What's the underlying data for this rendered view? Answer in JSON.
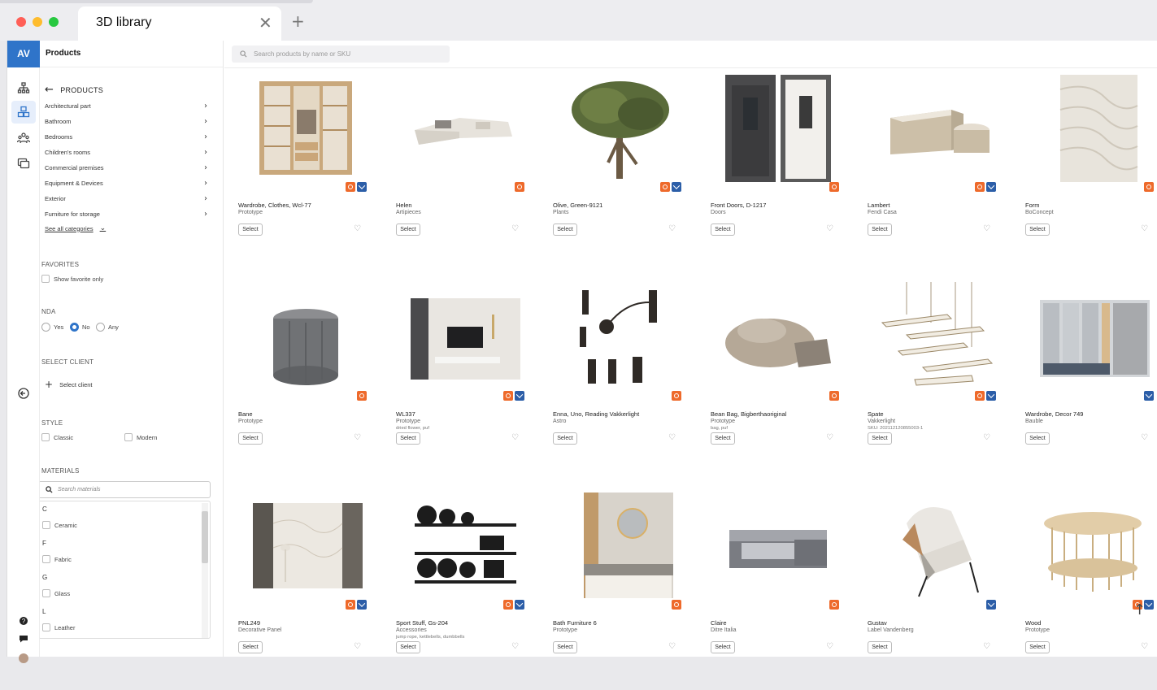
{
  "browser": {
    "tab_title": "3D library",
    "close_glyph": "✕",
    "new_tab_glyph": "+"
  },
  "rail": {
    "logo": "AV",
    "icons": [
      "sitemap-icon",
      "cubes-icon",
      "users-icon",
      "projects-icon",
      "collapse-icon",
      "help-icon",
      "chat-icon",
      "avatar"
    ]
  },
  "header": {
    "title": "Products"
  },
  "search": {
    "placeholder": "Search products by name or SKU"
  },
  "filters": {
    "back_label": "PRODUCTS",
    "categories": [
      "Architectural part",
      "Bathroom",
      "Bedrooms",
      "Children's rooms",
      "Commercial premises",
      "Equipment & Devices",
      "Exterior",
      "Furniture for storage"
    ],
    "see_all": "See all categories",
    "favorites": {
      "title": "FAVORITES",
      "option": "Show favorite only"
    },
    "nda": {
      "title": "NDA",
      "options": [
        "Yes",
        "No",
        "Any"
      ],
      "selected": "No"
    },
    "client": {
      "title": "SELECT CLIENT",
      "add_label": "Select client"
    },
    "style": {
      "title": "STYLE",
      "options": [
        "Classic",
        "Modern"
      ]
    },
    "materials": {
      "title": "MATERIALS",
      "placeholder": "Search materials",
      "groups": [
        {
          "letter": "C",
          "item": "Ceramic"
        },
        {
          "letter": "F",
          "item": "Fabric"
        },
        {
          "letter": "G",
          "item": "Glass"
        },
        {
          "letter": "L",
          "item": "Leather"
        }
      ]
    }
  },
  "card_ui": {
    "select_label": "Select",
    "heart_glyph": "♡"
  },
  "products": [
    {
      "name": "Wardrobe, Clothes, Wcl-77",
      "sub": "Prototype",
      "sub2": "",
      "badges": [
        "orange",
        "blue"
      ],
      "img": "wardrobe"
    },
    {
      "name": "Helen",
      "sub": "Artipieces",
      "sub2": "",
      "badges": [
        "orange"
      ],
      "img": "sofa"
    },
    {
      "name": "Olive, Green-9121",
      "sub": "Plants",
      "sub2": "",
      "badges": [
        "orange",
        "blue"
      ],
      "img": "tree"
    },
    {
      "name": "Front Doors, D-1217",
      "sub": "Doors",
      "sub2": "",
      "badges": [
        "orange"
      ],
      "img": "doors"
    },
    {
      "name": "Lambert",
      "sub": "Fendi Casa",
      "sub2": "",
      "badges": [
        "orange",
        "blue"
      ],
      "img": "table"
    },
    {
      "name": "Form",
      "sub": "BoConcept",
      "sub2": "",
      "badges": [
        "orange"
      ],
      "img": "rug"
    },
    {
      "name": "Bane",
      "sub": "Prototype",
      "sub2": "",
      "badges": [
        "orange"
      ],
      "img": "pouf"
    },
    {
      "name": "WL337",
      "sub": "Prototype",
      "sub2": "dried flower, puf",
      "badges": [
        "orange",
        "blue"
      ],
      "img": "tvwall"
    },
    {
      "name": "Enna, Uno, Reading Vakkerlight",
      "sub": "Astro",
      "sub2": "",
      "badges": [
        "orange"
      ],
      "img": "lamps"
    },
    {
      "name": "Bean Bag, Bigberthaoriginal",
      "sub": "Prototype",
      "sub2": "bag, puf",
      "badges": [
        "orange"
      ],
      "img": "beanbag"
    },
    {
      "name": "Spate",
      "sub": "Vakkerlight",
      "sub2": "SKU: 202112120855003-1",
      "badges": [
        "orange",
        "blue"
      ],
      "img": "chandelier"
    },
    {
      "name": "Wardrobe, Decor 749",
      "sub": "Bauble",
      "sub2": "",
      "badges": [
        "blue"
      ],
      "img": "kidswardrobe"
    },
    {
      "name": "PNL249",
      "sub": "Decorative Panel",
      "sub2": "",
      "badges": [
        "orange",
        "blue"
      ],
      "img": "panel"
    },
    {
      "name": "Sport Stuff, Gs-204",
      "sub": "Accessories",
      "sub2": "jump rope, kettlebells, dumbbells",
      "badges": [
        "orange",
        "blue"
      ],
      "img": "rack"
    },
    {
      "name": "Bath Furniture 6",
      "sub": "Prototype",
      "sub2": "",
      "badges": [
        "orange"
      ],
      "img": "bath"
    },
    {
      "name": "Claire",
      "sub": "Ditre Italia",
      "sub2": "",
      "badges": [
        "orange"
      ],
      "img": "bed"
    },
    {
      "name": "Gustav",
      "sub": "Label Vandenberg",
      "sub2": "",
      "badges": [
        "blue"
      ],
      "img": "chair"
    },
    {
      "name": "Wood",
      "sub": "Prototype",
      "sub2": "",
      "badges": [
        "orange",
        "blue"
      ],
      "img": "roundtable"
    }
  ],
  "scroll_top_glyph": "↑"
}
